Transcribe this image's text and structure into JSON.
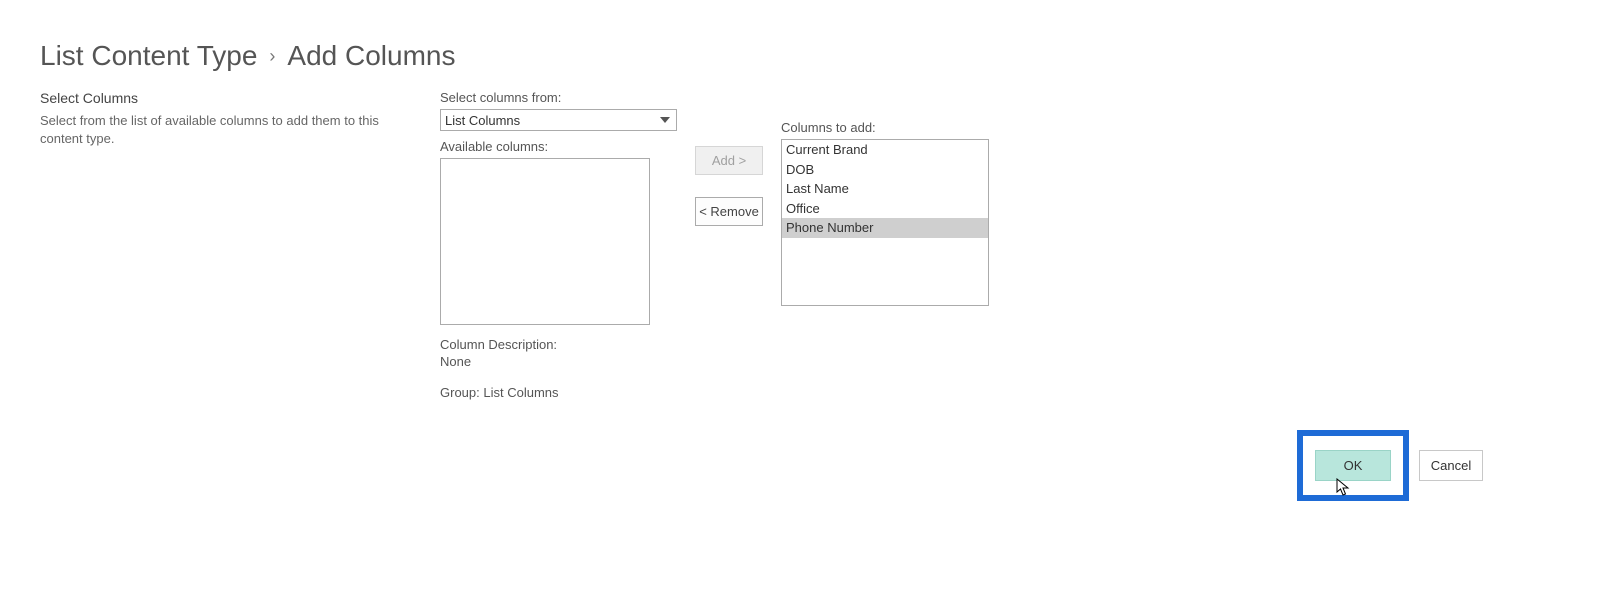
{
  "breadcrumb": {
    "parent": "List Content Type",
    "separator": "›",
    "current": "Add Columns"
  },
  "section": {
    "title": "Select Columns",
    "description": "Select from the list of available columns to add them to this content type."
  },
  "selectFrom": {
    "label": "Select columns from:",
    "value": "List Columns"
  },
  "available": {
    "label": "Available columns:",
    "items": []
  },
  "toAdd": {
    "label": "Columns to add:",
    "items": [
      {
        "label": "Current Brand",
        "selected": false
      },
      {
        "label": "DOB",
        "selected": false
      },
      {
        "label": "Last Name",
        "selected": false
      },
      {
        "label": "Office",
        "selected": false
      },
      {
        "label": "Phone Number",
        "selected": true
      }
    ]
  },
  "buttons": {
    "add": "Add >",
    "remove": "< Remove",
    "ok": "OK",
    "cancel": "Cancel"
  },
  "columnDescription": {
    "label": "Column Description:",
    "value": "None"
  },
  "group": {
    "label": "Group:",
    "value": "List Columns"
  }
}
